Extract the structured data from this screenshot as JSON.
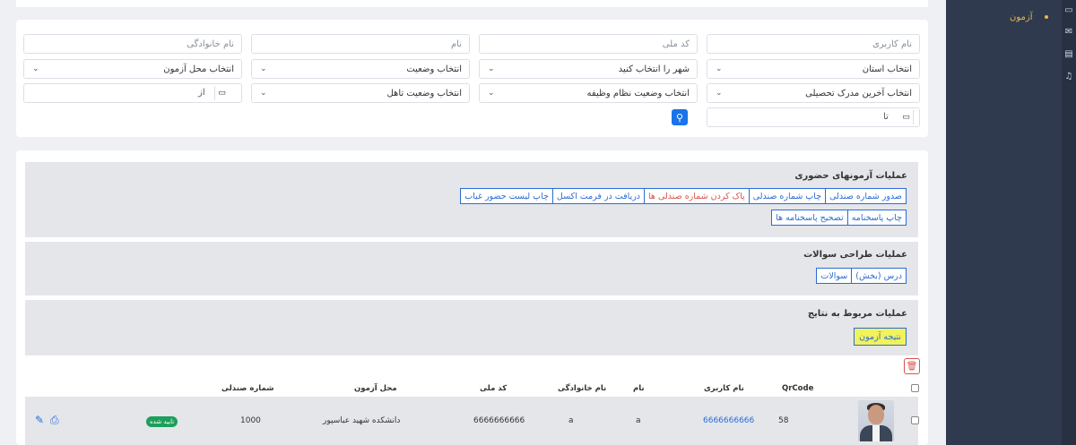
{
  "sidebar": {
    "menu_item": "آزمون",
    "icons": [
      "monitor-icon",
      "mail-icon",
      "document-icon",
      "headset-icon"
    ]
  },
  "filters": {
    "username_ph": "نام کاربری",
    "national_code_ph": "کد ملی",
    "first_name_ph": "نام",
    "last_name_ph": "نام خانوادگی",
    "province": "انتخاب استان",
    "city": "شهر را انتخاب کنید",
    "status": "انتخاب وضعیت",
    "exam_location": "انتخاب محل آزمون",
    "degree": "انتخاب آخرین مدرک تحصیلی",
    "military": "انتخاب وضعیت نظام وظیفه",
    "marital": "انتخاب وضعیت تاهل",
    "from_label": "از",
    "to_label": "تا"
  },
  "panels": {
    "onsite": {
      "title": "عملیات آزمونهای حضوری",
      "row1": [
        "صدور شماره صندلی",
        "چاپ شماره صندلی",
        "پاک کردن شماره صندلی ها",
        "دریافت در فرمت اکسل",
        "چاپ لیست حضور غیاب"
      ],
      "row2": [
        "چاپ پاسخنامه",
        "تصحیح پاسخنامه ها"
      ]
    },
    "questions": {
      "title": "عملیات طراحی سوالات",
      "buttons": [
        "درس (بخش)",
        "سوالات"
      ]
    },
    "results": {
      "title": "عملیات مربوط به نتایج",
      "buttons": [
        "نتیجه آزمون"
      ]
    }
  },
  "table": {
    "headers": {
      "qrcode": "QrCode",
      "username": "نام کاربری",
      "first_name": "نام",
      "last_name": "نام خانوادگی",
      "national_code": "کد ملی",
      "location": "محل آزمون",
      "seat": "شماره صندلی"
    },
    "rows": [
      {
        "qrcode": "58",
        "username": "6666666666",
        "first_name": "a",
        "last_name": "a",
        "national_code": "6666666666",
        "location": "دانشکده شهید عباسپور",
        "seat": "1000",
        "status": "تایید شده"
      }
    ]
  },
  "colors": {
    "sidebar_bg": "#2f3a4f",
    "accent_blue": "#2b6cd6",
    "danger": "#d9534f",
    "highlight": "#f2f25a",
    "badge_green": "#1e9e5a",
    "active_menu": "#e8b84a"
  }
}
